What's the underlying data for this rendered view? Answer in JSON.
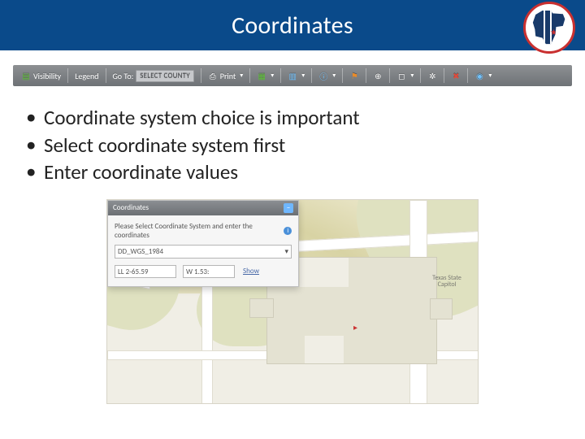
{
  "header": {
    "title": "Coordinates"
  },
  "toolbar": {
    "visibility_label": "Visibility",
    "legend_label": "Legend",
    "goto_label": "Go To:",
    "goto_value": "SELECT COUNTY",
    "print_label": "Print"
  },
  "bullets": {
    "items": [
      "Coordinate system choice is important",
      "Select coordinate system first",
      "Enter coordinate values"
    ]
  },
  "map": {
    "feature_label": "Texas State Capitol"
  },
  "coord_panel": {
    "title": "Coordinates",
    "instruction": "Please Select Coordinate System and enter the coordinates",
    "system_value": "DD_WGS_1984",
    "lat_value": "LL 2-65.59",
    "lon_value": "W  1.53:",
    "show_label": "Show"
  }
}
